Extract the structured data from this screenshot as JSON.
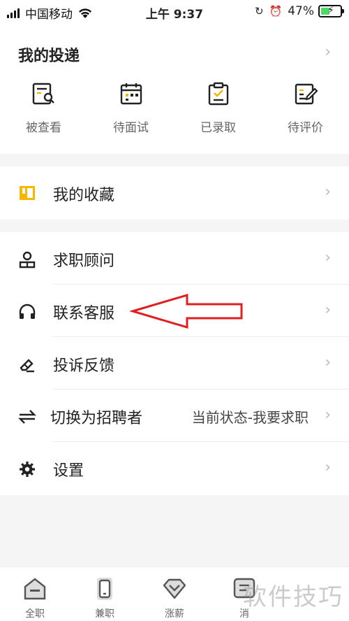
{
  "status_bar": {
    "carrier": "中国移动",
    "time": "上午 9:37",
    "battery_percent": "47%",
    "battery_level": 0.47,
    "icons": [
      "signal-icon",
      "wifi-icon",
      "rotation-lock-icon",
      "alarm-icon",
      "battery-icon"
    ]
  },
  "applications": {
    "title": "我的投递",
    "items": [
      {
        "label": "被查看",
        "icon": "resume-viewed-icon"
      },
      {
        "label": "待面试",
        "icon": "calendar-icon"
      },
      {
        "label": "已录取",
        "icon": "clipboard-check-icon"
      },
      {
        "label": "待评价",
        "icon": "edit-note-icon"
      }
    ]
  },
  "favorites": {
    "label": "我的收藏",
    "icon": "bookmark-icon"
  },
  "menu": {
    "items": [
      {
        "label": "求职顾问",
        "icon": "advisor-icon",
        "value": ""
      },
      {
        "label": "联系客服",
        "icon": "headset-icon",
        "value": ""
      },
      {
        "label": "投诉反馈",
        "icon": "eraser-icon",
        "value": ""
      },
      {
        "label": "切换为招聘者",
        "icon": "switch-icon",
        "value": "当前状态-我要求职"
      },
      {
        "label": "设置",
        "icon": "gear-icon",
        "value": ""
      }
    ]
  },
  "bottom_nav": {
    "items": [
      {
        "label": "全职",
        "icon": "home-icon"
      },
      {
        "label": "兼职",
        "icon": "phone-icon"
      },
      {
        "label": "涨薪",
        "icon": "diamond-icon"
      },
      {
        "label": "消",
        "icon": "message-icon"
      }
    ]
  },
  "watermark": "软件技巧",
  "colors": {
    "accent": "#f5b800",
    "annotation": "#e02020",
    "battery": "#4cd964"
  }
}
